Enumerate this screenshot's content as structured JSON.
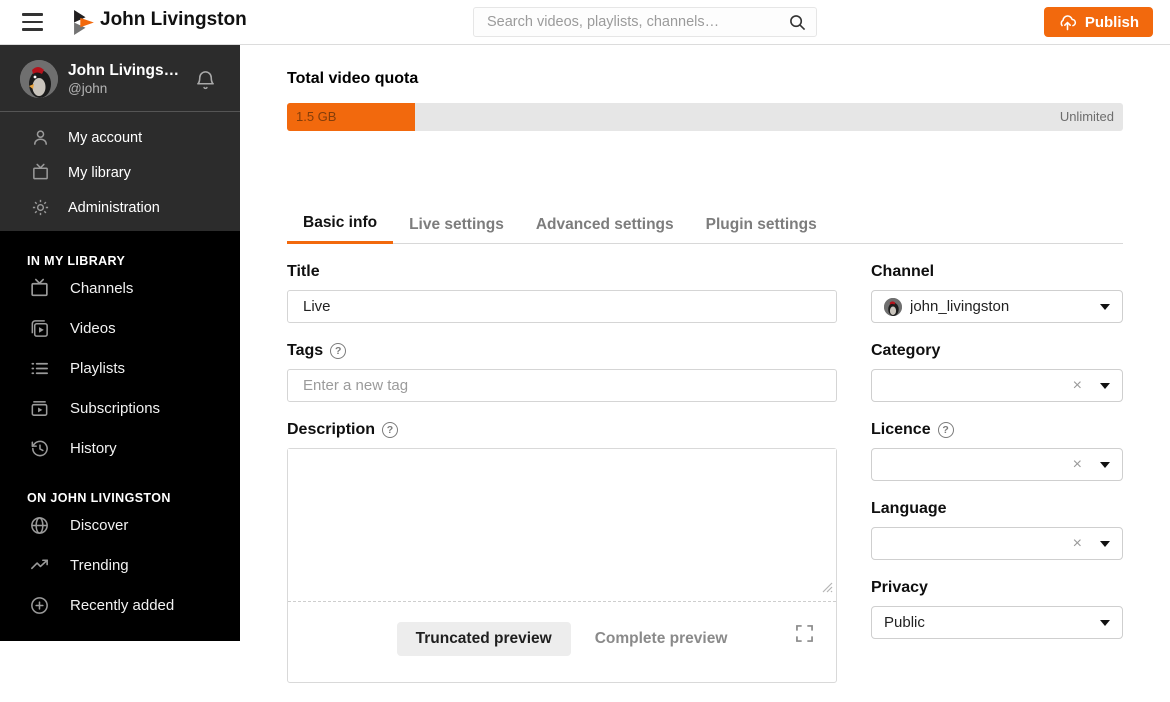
{
  "colors": {
    "accent": "#f2690d",
    "sidebar_bg": "#000000",
    "sidebar_top_bg": "#2c2c2c",
    "quota_track": "#e6e6e6"
  },
  "icons": {
    "menu-icon": "☰",
    "peertube-logo": "play-triangles",
    "search-icon": "magnifier",
    "upload-icon": "cloud-up-arrow",
    "bell-icon": "bell",
    "user-icon": "person",
    "tv-icon": "television",
    "gear-icon": "gear",
    "videos-icon": "stacked-video",
    "playlist-icon": "list",
    "subscriptions-icon": "inbox-play",
    "history-icon": "clock-back",
    "globe-icon": "globe",
    "trending-icon": "trend-arrow",
    "plus-circle-icon": "circled-plus",
    "help-icon": "?",
    "caret-down-icon": "▾",
    "clear-icon": "×",
    "fullscreen-icon": "corner-brackets",
    "resize-handle-icon": "diagonal-grip"
  },
  "header": {
    "instance_title": "John Livingston",
    "search_placeholder": "Search videos, playlists, channels…",
    "publish_label": "Publish"
  },
  "sidebar": {
    "user": {
      "name": "John Livings…",
      "handle": "@john"
    },
    "menu": [
      {
        "label": "My account"
      },
      {
        "label": "My library"
      },
      {
        "label": "Administration"
      }
    ],
    "sections": [
      {
        "title": "IN MY LIBRARY",
        "items": [
          {
            "label": "Channels"
          },
          {
            "label": "Videos"
          },
          {
            "label": "Playlists"
          },
          {
            "label": "Subscriptions"
          },
          {
            "label": "History"
          }
        ]
      },
      {
        "title": "ON JOHN LIVINGSTON",
        "items": [
          {
            "label": "Discover"
          },
          {
            "label": "Trending"
          },
          {
            "label": "Recently added"
          }
        ]
      }
    ]
  },
  "main": {
    "quota": {
      "title": "Total video quota",
      "used_label": "1.5 GB",
      "used_percent": 15.3,
      "limit_label": "Unlimited"
    },
    "tabs": [
      {
        "label": "Basic info",
        "active": true
      },
      {
        "label": "Live settings",
        "active": false
      },
      {
        "label": "Advanced settings",
        "active": false
      },
      {
        "label": "Plugin settings",
        "active": false
      }
    ],
    "form": {
      "title": {
        "label": "Title",
        "value": "Live"
      },
      "tags": {
        "label": "Tags",
        "placeholder": "Enter a new tag"
      },
      "description": {
        "label": "Description",
        "value": "",
        "truncated_preview_label": "Truncated preview",
        "complete_preview_label": "Complete preview"
      },
      "channel": {
        "label": "Channel",
        "value": "john_livingston"
      },
      "category": {
        "label": "Category",
        "value": ""
      },
      "licence": {
        "label": "Licence",
        "value": ""
      },
      "language": {
        "label": "Language",
        "value": ""
      },
      "privacy": {
        "label": "Privacy",
        "value": "Public"
      }
    }
  }
}
